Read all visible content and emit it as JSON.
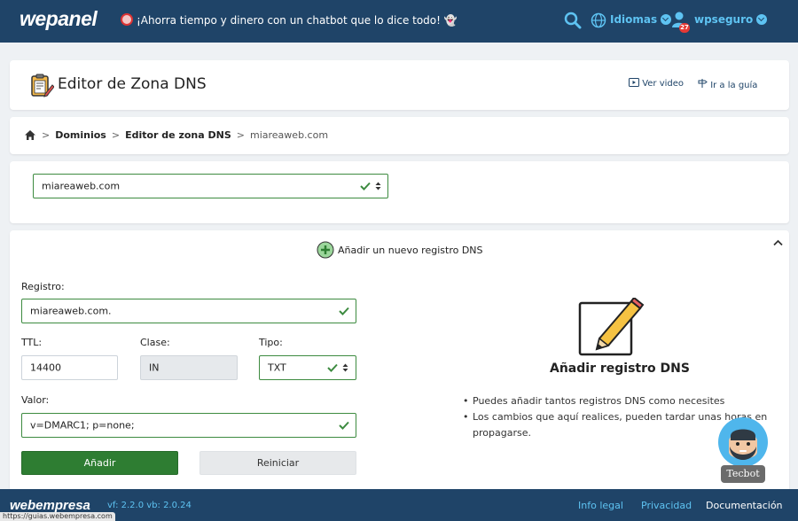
{
  "header": {
    "logo": "wepanel",
    "promo": "¡Ahorra tiempo y dinero con un chatbot que lo dice todo! 👻",
    "languages_label": "Idiomas",
    "user_name": "wpseguro",
    "notification_count": "27"
  },
  "title_bar": {
    "title": "Editor de Zona DNS",
    "video_link": "Ver video",
    "guide_link": "Ir a la guía"
  },
  "breadcrumb": {
    "items": [
      "Dominios",
      "Editor de zona DNS",
      "miareaweb.com"
    ]
  },
  "domain_select": {
    "value": "miareaweb.com"
  },
  "form": {
    "heading": "Añadir un nuevo registro DNS",
    "registro_label": "Registro:",
    "registro_value": "miareaweb.com.",
    "ttl_label": "TTL:",
    "ttl_value": "14400",
    "clase_label": "Clase:",
    "clase_value": "IN",
    "tipo_label": "Tipo:",
    "tipo_value": "TXT",
    "valor_label": "Valor:",
    "valor_value": "v=DMARC1; p=none;",
    "add_button": "Añadir",
    "reset_button": "Reiniciar"
  },
  "side_panel": {
    "title": "Añadir registro DNS",
    "tips": [
      "Puedes añadir tantos registros DNS como necesites",
      "Los cambios que aquí realices, pueden tardar unas horas en propagarse."
    ]
  },
  "tecbot": {
    "label": "Tecbot"
  },
  "footer": {
    "logo": "webempresa",
    "version": "vf: 2.2.0 vb: 2.0.24",
    "links": [
      "Info legal",
      "Privacidad",
      "Documentación"
    ]
  },
  "status_bar": {
    "url": "https://guias.webempresa.com"
  },
  "colors": {
    "header_bg": "#1f4468",
    "accent_blue": "#5ec3f2",
    "success_green": "#2e7d32",
    "check_green": "#3d8b40"
  }
}
